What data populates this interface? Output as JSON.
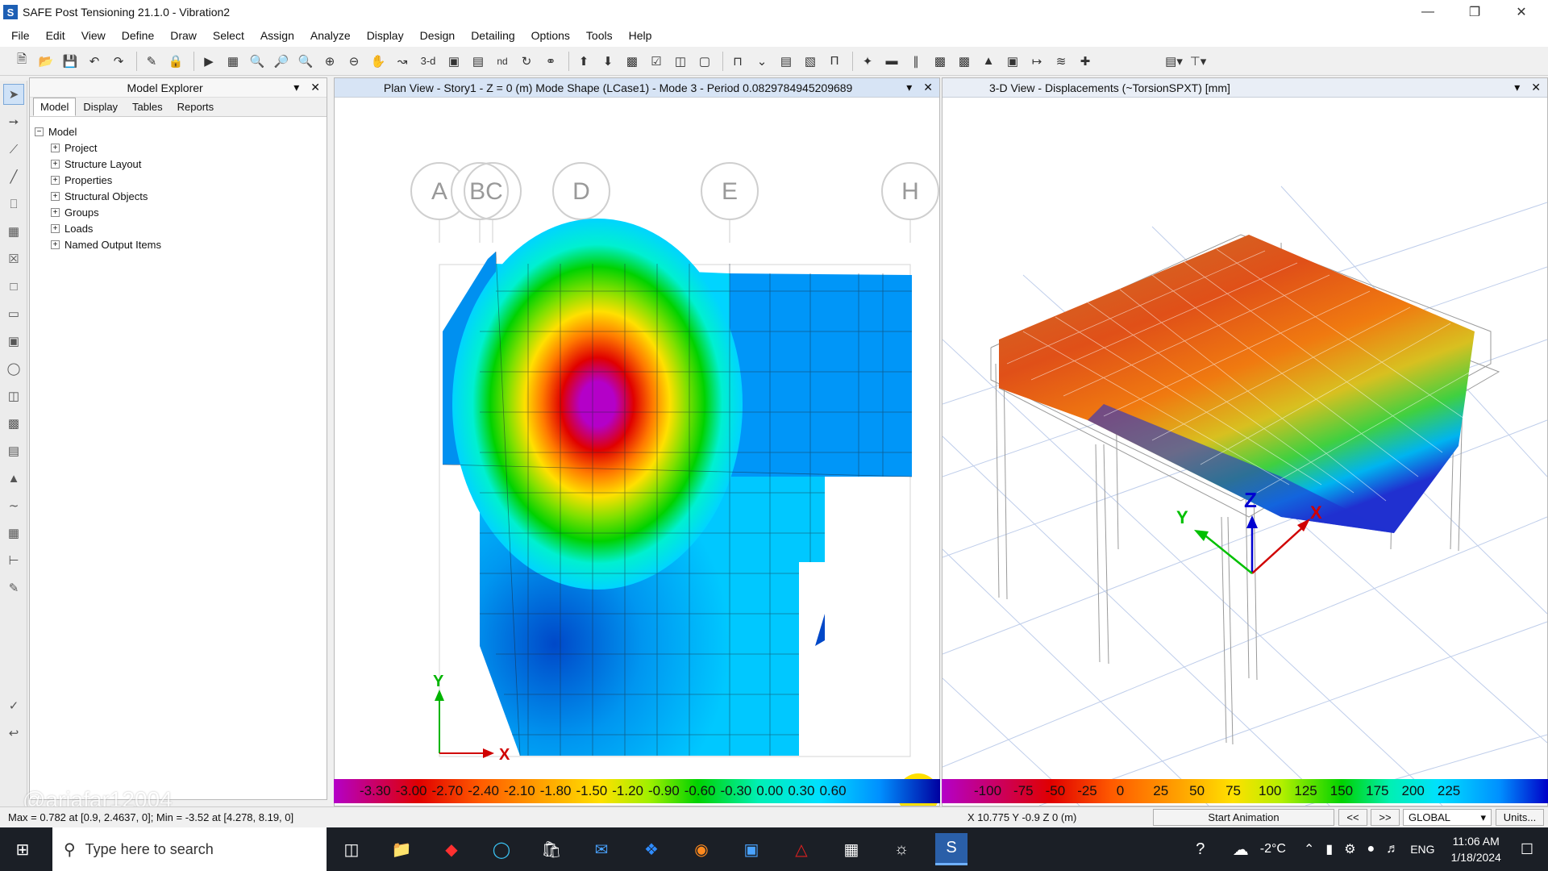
{
  "app": {
    "title": "SAFE Post Tensioning 21.1.0 - Vibration2",
    "logo": "S"
  },
  "window_controls": {
    "minimize_icon": "minimize-icon",
    "restore_icon": "restore-icon",
    "close_icon": "close-icon"
  },
  "menu": [
    "File",
    "Edit",
    "View",
    "Define",
    "Draw",
    "Select",
    "Assign",
    "Analyze",
    "Display",
    "Design",
    "Detailing",
    "Options",
    "Tools",
    "Help"
  ],
  "toolbar": {
    "view_3d": "3-d",
    "view_nd": "nd"
  },
  "explorer": {
    "title": "Model Explorer",
    "tabs": [
      "Model",
      "Display",
      "Tables",
      "Reports"
    ],
    "root": "Model",
    "items": [
      "Project",
      "Structure Layout",
      "Properties",
      "Structural Objects",
      "Groups",
      "Loads",
      "Named Output Items"
    ]
  },
  "plan_view": {
    "title": "Plan View - Story1 - Z = 0 (m)  Mode Shape (LCase1) - Mode 3 - Period 0.0829784945209689",
    "grid_labels": [
      "A",
      "BC",
      "D",
      "E",
      "H"
    ],
    "axis_x": "X",
    "axis_y": "Y",
    "legend": [
      "-3.30",
      "-3.00",
      "-2.70",
      "-2.40",
      "-2.10",
      "-1.80",
      "-1.50",
      "-1.20",
      "-0.90",
      "-0.60",
      "-0.30",
      "0.00",
      "0.30",
      "0.60"
    ]
  },
  "view3d": {
    "title": "3-D View   - Displacements (~TorsionSPXT)  [mm]",
    "legend": [
      "-100",
      "-75",
      "-50",
      "-25",
      "0",
      "25",
      "50",
      "75",
      "100",
      "125",
      "150",
      "175",
      "200",
      "225"
    ],
    "axes": {
      "x": "X",
      "y": "Y",
      "z": "Z"
    }
  },
  "status": {
    "left": "Max = 0.782 at [0.9, 2.4637, 0];  Min = -3.52 at [4.278, 8.19, 0]",
    "coords": "X 10.775  Y -0.9  Z 0 (m)",
    "start_animation": "Start Animation",
    "prev": "<<",
    "next": ">>",
    "coord_system": "GLOBAL",
    "units": "Units..."
  },
  "watermark": "@ariafar12004",
  "taskbar": {
    "search_placeholder": "Type here to search",
    "temperature": "-2°C",
    "language": "ENG",
    "time": "11:06 AM",
    "date": "1/18/2024"
  },
  "colors": {
    "accent": "#1d5fb4",
    "contour": [
      "#b400c8",
      "#e00000",
      "#ff5a00",
      "#ff9a00",
      "#ffe000",
      "#b4f000",
      "#00d200",
      "#00f0b4",
      "#00e0ff",
      "#00b4ff",
      "#0070e0",
      "#0000c8"
    ]
  }
}
